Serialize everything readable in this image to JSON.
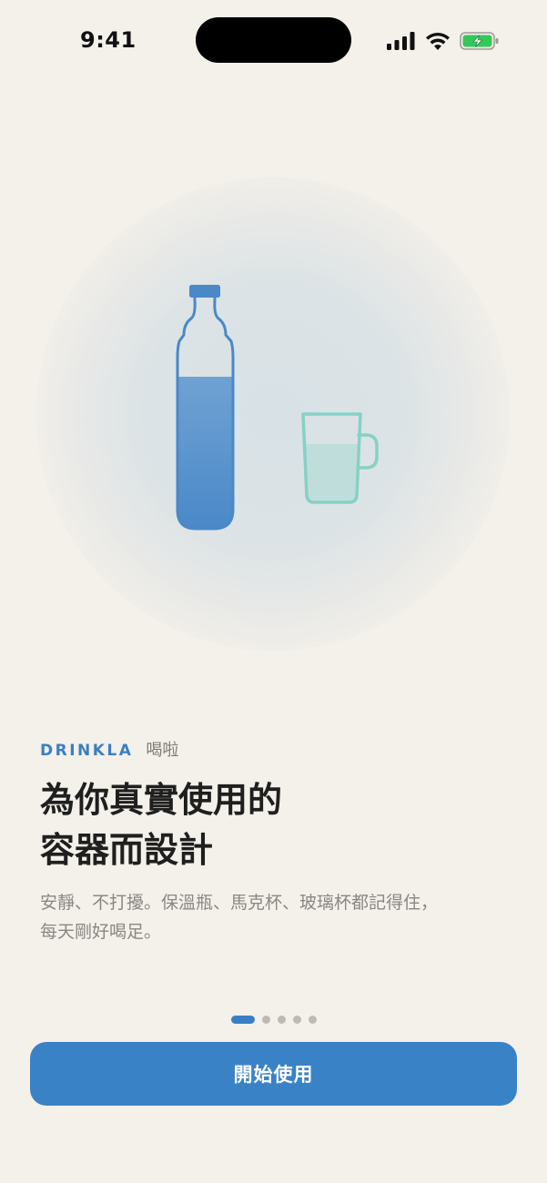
{
  "status_bar": {
    "time": "9:41",
    "icons": [
      "cellular-signal-icon",
      "wifi-icon",
      "battery-charging-icon"
    ]
  },
  "illustration": {
    "items": [
      "water-bottle-icon",
      "mug-icon"
    ],
    "bottle_fill_level": 0.62,
    "mug_fill_level": 0.6,
    "colors": {
      "bottle": "#4A88C8",
      "mug": "#86D1C5",
      "glow": "#DCE3E7"
    }
  },
  "onboarding": {
    "brand": "DRINKLA",
    "brand_subtitle": "喝啦",
    "title_lines": [
      "為你真實使用的",
      "容器而設計"
    ],
    "description_lines": [
      "安靜、不打擾。保溫瓶、馬克杯、玻璃杯都記得住，",
      "每天剛好喝足。"
    ]
  },
  "pager": {
    "total_pages": 5,
    "current_page": 1
  },
  "cta": {
    "label": "開始使用"
  },
  "colors": {
    "background": "#F4F0EA",
    "accent": "#3A82C6",
    "text_primary": "#1F1F1F",
    "text_secondary": "#8A8784"
  }
}
